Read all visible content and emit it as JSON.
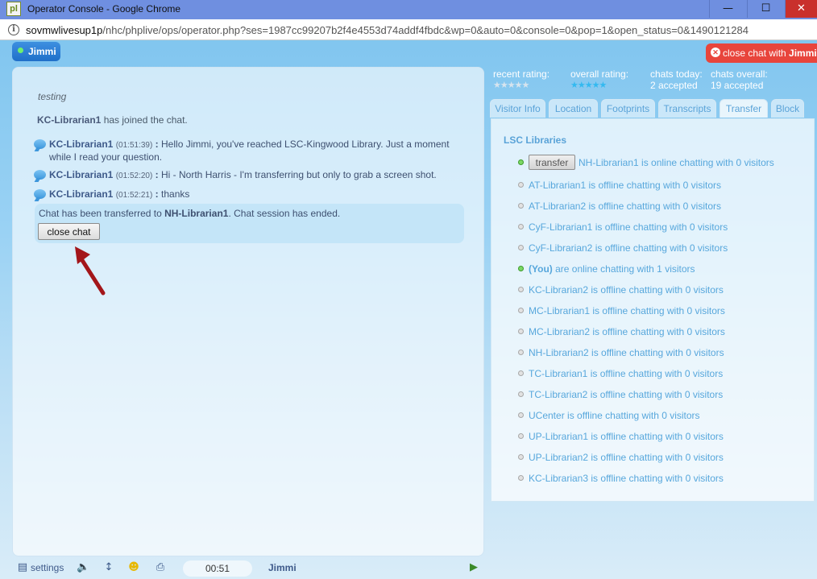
{
  "window": {
    "logo": "pl",
    "title": "Operator Console - Google Chrome",
    "min": "—",
    "max": "☐",
    "close": "✕"
  },
  "url": {
    "host": "sovmwlivesup1p",
    "path": "/nhc/phplive/ops/operator.php?ses=1987cc99207b2f4e4553d74addf4fbdc&wp=0&auto=0&console=0&pop=1&open_status=0&1490121284"
  },
  "operator_tab": {
    "name": "Jimmi"
  },
  "close_chat_top": {
    "prefix": "close chat with ",
    "name": "Jimmi"
  },
  "chat": {
    "system_italic": "testing",
    "joined": {
      "who": "KC-Librarian1",
      "text": " has joined the chat."
    },
    "messages": [
      {
        "who": "KC-Librarian1",
        "time": "01:51:39",
        "text": "Hello Jimmi, you've reached LSC-Kingwood Library. Just a moment while I read your question."
      },
      {
        "who": "KC-Librarian1",
        "time": "01:52:20",
        "text": "Hi - North Harris - I'm transferring but only to grab a screen shot."
      },
      {
        "who": "KC-Librarian1",
        "time": "01:52:21",
        "text": "thanks"
      }
    ],
    "transfer_notice": {
      "pre": "Chat has been transferred to ",
      "target": "NH-Librarian1",
      "post": ". Chat session has ended."
    },
    "close_button": "close chat"
  },
  "bottom_bar": {
    "settings": "settings",
    "timer": "00:51",
    "visitor": "Jimmi"
  },
  "stats": {
    "recent_rating_label": "recent rating:",
    "overall_rating_label": "overall rating:",
    "overall_rating_stars": 5,
    "chats_today_label": "chats today:",
    "chats_today_value": "2 accepted",
    "chats_overall_label": "chats overall:",
    "chats_overall_value": "19 accepted"
  },
  "tabs": [
    "Visitor Info",
    "Location",
    "Footprints",
    "Transcripts",
    "Transfer",
    "Block"
  ],
  "transfer": {
    "department": "LSC Libraries",
    "transfer_button": "transfer",
    "operators": [
      {
        "name": "NH-Librarian1",
        "status": "is online chatting with 0 visitors",
        "online": true
      },
      {
        "name": "AT-Librarian1",
        "status": "is offline chatting with 0 visitors",
        "online": false
      },
      {
        "name": "AT-Librarian2",
        "status": "is offline chatting with 0 visitors",
        "online": false
      },
      {
        "name": "CyF-Librarian1",
        "status": "is offline chatting with 0 visitors",
        "online": false
      },
      {
        "name": "CyF-Librarian2",
        "status": "is offline chatting with 0 visitors",
        "online": false
      },
      {
        "name": "(You)",
        "status": "are online chatting with 1 visitors",
        "online": true
      },
      {
        "name": "KC-Librarian2",
        "status": "is offline chatting with 0 visitors",
        "online": false
      },
      {
        "name": "MC-Librarian1",
        "status": "is offline chatting with 0 visitors",
        "online": false
      },
      {
        "name": "MC-Librarian2",
        "status": "is offline chatting with 0 visitors",
        "online": false
      },
      {
        "name": "NH-Librarian2",
        "status": "is offline chatting with 0 visitors",
        "online": false
      },
      {
        "name": "TC-Librarian1",
        "status": "is offline chatting with 0 visitors",
        "online": false
      },
      {
        "name": "TC-Librarian2",
        "status": "is offline chatting with 0 visitors",
        "online": false
      },
      {
        "name": "UCenter",
        "status": "is offline chatting with 0 visitors",
        "online": false
      },
      {
        "name": "UP-Librarian1",
        "status": "is offline chatting with 0 visitors",
        "online": false
      },
      {
        "name": "UP-Librarian2",
        "status": "is offline chatting with 0 visitors",
        "online": false
      },
      {
        "name": "KC-Librarian3",
        "status": "is offline chatting with 0 visitors",
        "online": false
      }
    ]
  },
  "icons": {
    "settings": "settings-icon",
    "sound": "speaker-icon",
    "arrows": "up-down-arrows-icon",
    "emoji": "smiley-icon",
    "print": "printer-icon",
    "expand": "expand-icon"
  },
  "colors": {
    "accent_blue": "#5aa3d8",
    "close_red": "#e8453c",
    "arrow_red": "#a3161a"
  }
}
